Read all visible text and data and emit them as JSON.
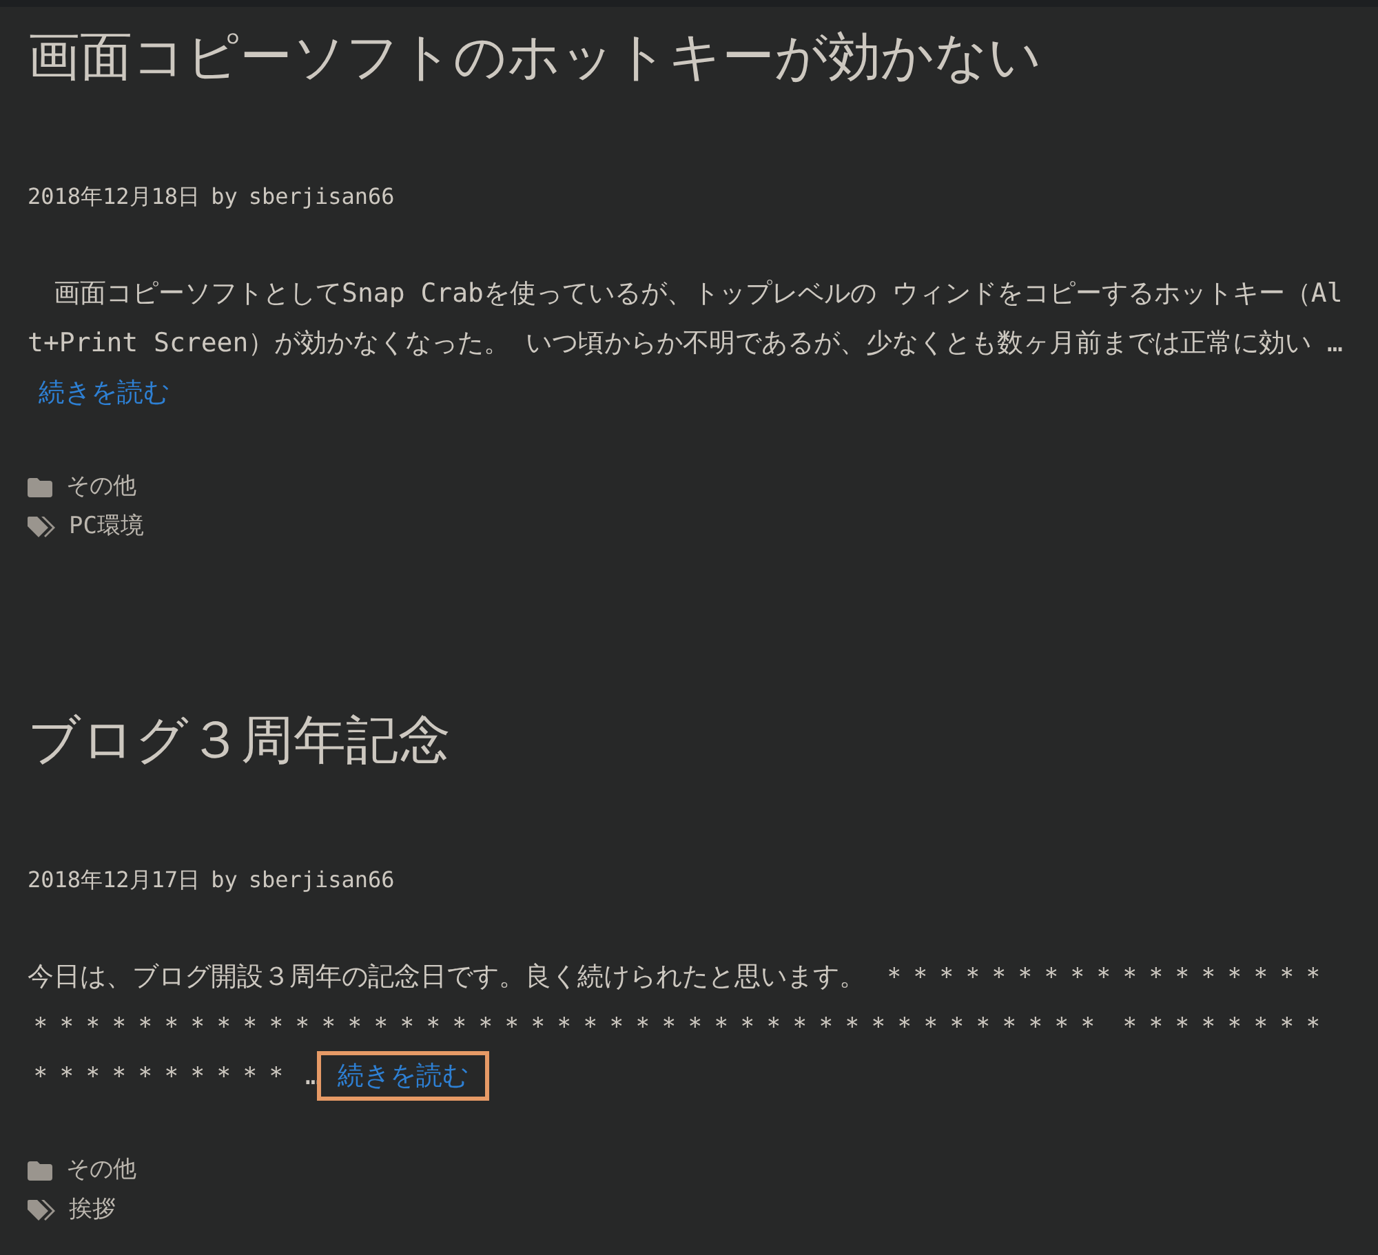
{
  "posts": [
    {
      "title": "画面コピーソフトのホットキーが効かない",
      "date": "2018年12月18日",
      "by": "by",
      "author": "sberjisan66",
      "excerpt": "　画面コピーソフトとしてSnap Crabを使っているが、トップレベルの ウィンドをコピーするホットキー（Alt+Print Screen）が効かなくなった。 いつ頃からか不明であるが、少なくとも数ヶ月前までは正常に効い …",
      "more": {
        "label": "続きを読む",
        "focused": false
      },
      "category": "その他",
      "tag": "PC環境"
    },
    {
      "title": "ブログ３周年記念",
      "date": "2018年12月17日",
      "by": "by",
      "author": "sberjisan66",
      "excerpt": "今日は、ブログ開設３周年の記念日です。良く続けられたと思います。 ＊＊＊＊＊＊＊＊＊＊＊＊＊＊＊＊＊＊＊＊＊＊＊＊＊＊＊＊＊＊＊＊＊＊＊＊＊＊＊＊＊＊＊＊＊＊＊＊＊＊＊＊＊＊＊＊＊＊ ＊＊＊＊＊＊＊＊＊＊＊＊＊＊＊＊＊＊ …",
      "more": {
        "label": "続きを読む",
        "focused": true
      },
      "category": "その他",
      "tag": "挨拶"
    }
  ]
}
